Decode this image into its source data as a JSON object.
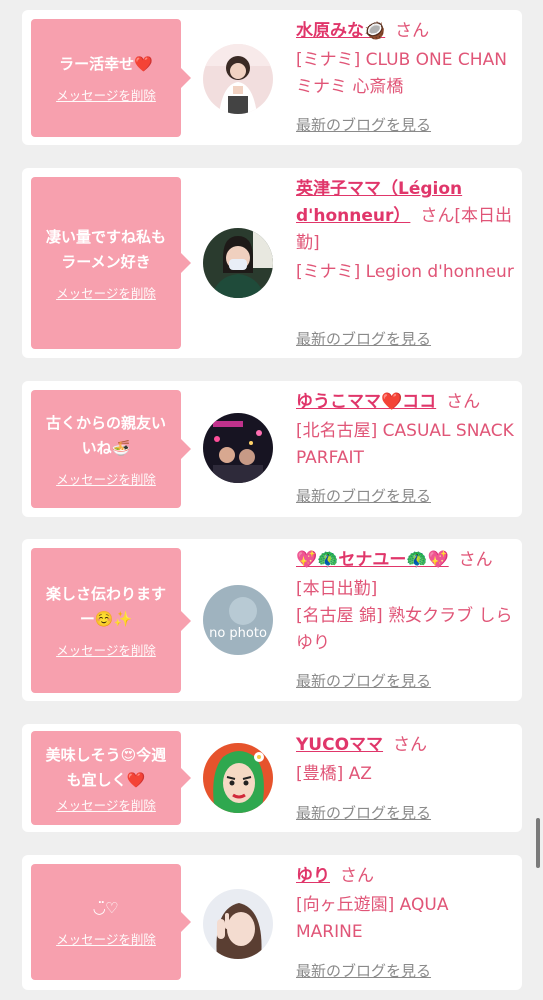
{
  "colors": {
    "bubble": "#f7a0ae",
    "name": "#e0366a",
    "shop": "#e05577",
    "blog": "#8a8a8a"
  },
  "common": {
    "delete_label": "メッセージを削除",
    "blog_label": "最新のブログを見る",
    "san": "さん"
  },
  "items": [
    {
      "message": "ラー活幸せ❤️",
      "name": "水原みな🥥",
      "name_suffix": "",
      "shop": "[ミナミ] CLUB ONE CHAN ミナミ 心斎橋",
      "avatar": "woman-white-top"
    },
    {
      "message": "凄い量ですね私も\nラーメン好き",
      "name": "英津子ママ（Légion d'honneur）",
      "name_suffix": "[本日出勤]",
      "shop": "[ミナミ] Legion d'honneur",
      "avatar": "woman-mask"
    },
    {
      "message": "古くからの親友い\nいね🍜",
      "name": "ゆうこママ❤️ココ",
      "name_suffix": "",
      "shop": "[北名古屋] CASUAL SNACK PARFAIT",
      "avatar": "night-bar"
    },
    {
      "message": "楽しさ伝わります\nー☺️✨",
      "name": "💖🦚セナユー🦚💖",
      "name_suffix": "",
      "shop": "[本日出勤]\n[名古屋 錦] 熟女クラブ しらゆり",
      "avatar": "no-photo"
    },
    {
      "message": "美味しそう😍今週\nも宜しく❤️",
      "name": "YUCOママ",
      "name_suffix": "",
      "shop": "[豊橋] AZ",
      "avatar": "green-hair-illustration"
    },
    {
      "message": "◡̈♡",
      "name": "ゆり",
      "name_suffix": "",
      "shop": "[向ヶ丘遊園] AQUA MARINE",
      "avatar": "peace-sign-selfie"
    }
  ]
}
